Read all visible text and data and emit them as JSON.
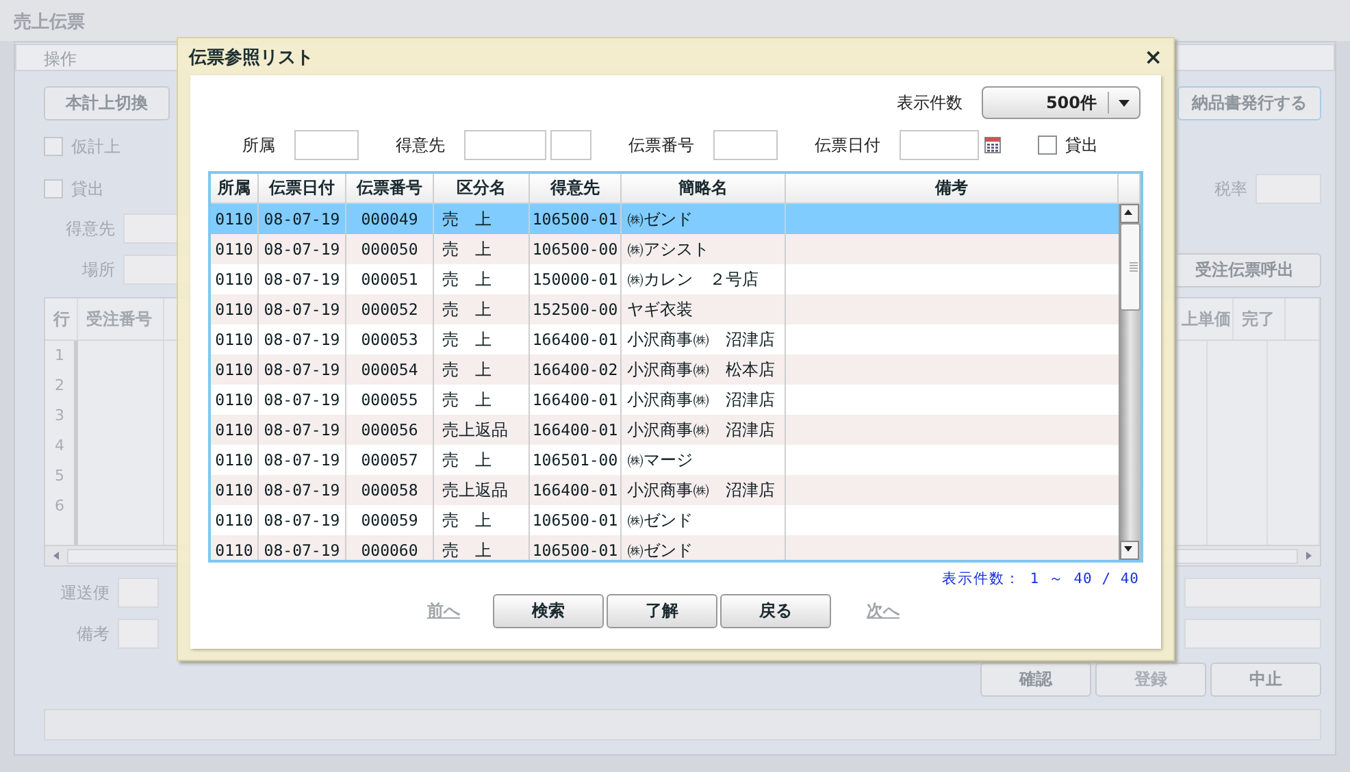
{
  "app": {
    "title": "売上伝票",
    "menu_tab": "操作",
    "top_buttons": [
      {
        "label": "本計上切換"
      },
      {
        "label": "納品書発行する"
      }
    ],
    "checkboxes": [
      {
        "label": "仮計上",
        "checked": false
      },
      {
        "label": "貸出",
        "checked": false
      }
    ],
    "fields": [
      {
        "label": "得意先"
      },
      {
        "label": "場所"
      }
    ],
    "tax_label": "税率",
    "call_button": "受注伝票呼出",
    "grid": {
      "columns_left": [
        "行",
        "受注番号"
      ],
      "columns_right": [
        "上単価",
        "完了"
      ],
      "row_numbers": [
        "1",
        "2",
        "3",
        "4",
        "5",
        "6"
      ]
    },
    "bottom_fields": [
      {
        "label": "運送便"
      },
      {
        "label": "備考"
      }
    ],
    "actions": [
      {
        "label": "確認",
        "disabled": false
      },
      {
        "label": "登録",
        "disabled": true
      },
      {
        "label": "中止",
        "disabled": false
      }
    ]
  },
  "dialog": {
    "title": "伝票参照リスト",
    "close": "×",
    "page_size": {
      "label": "表示件数",
      "value": "500件"
    },
    "filters": [
      {
        "label": "所属",
        "kind": "text"
      },
      {
        "label": "得意先",
        "kind": "split"
      },
      {
        "label": "伝票番号",
        "kind": "text"
      },
      {
        "label": "伝票日付",
        "kind": "date"
      },
      {
        "label": "貸出",
        "kind": "checkbox",
        "checked": false
      }
    ],
    "columns": [
      "所属",
      "伝票日付",
      "伝票番号",
      "区分名",
      "得意先",
      "簡略名",
      "備考"
    ],
    "rows": [
      {
        "cells": [
          "0110",
          "08-07-19",
          "000049",
          "売　上",
          "106500-01",
          "㈱ゼンド",
          ""
        ],
        "selected": true
      },
      {
        "cells": [
          "0110",
          "08-07-19",
          "000050",
          "売　上",
          "106500-00",
          "㈱アシスト",
          ""
        ],
        "selected": false
      },
      {
        "cells": [
          "0110",
          "08-07-19",
          "000051",
          "売　上",
          "150000-01",
          "㈱カレン　２号店",
          ""
        ],
        "selected": false
      },
      {
        "cells": [
          "0110",
          "08-07-19",
          "000052",
          "売　上",
          "152500-00",
          "ヤギ衣装",
          ""
        ],
        "selected": false
      },
      {
        "cells": [
          "0110",
          "08-07-19",
          "000053",
          "売　上",
          "166400-01",
          "小沢商事㈱　沼津店",
          ""
        ],
        "selected": false
      },
      {
        "cells": [
          "0110",
          "08-07-19",
          "000054",
          "売　上",
          "166400-02",
          "小沢商事㈱　松本店",
          ""
        ],
        "selected": false
      },
      {
        "cells": [
          "0110",
          "08-07-19",
          "000055",
          "売　上",
          "166400-01",
          "小沢商事㈱　沼津店",
          ""
        ],
        "selected": false
      },
      {
        "cells": [
          "0110",
          "08-07-19",
          "000056",
          "売上返品",
          "166400-01",
          "小沢商事㈱　沼津店",
          ""
        ],
        "selected": false
      },
      {
        "cells": [
          "0110",
          "08-07-19",
          "000057",
          "売　上",
          "106501-00",
          "㈱マージ",
          ""
        ],
        "selected": false
      },
      {
        "cells": [
          "0110",
          "08-07-19",
          "000058",
          "売上返品",
          "166400-01",
          "小沢商事㈱　沼津店",
          ""
        ],
        "selected": false
      },
      {
        "cells": [
          "0110",
          "08-07-19",
          "000059",
          "売　上",
          "106500-01",
          "㈱ゼンド",
          ""
        ],
        "selected": false
      },
      {
        "cells": [
          "0110",
          "08-07-19",
          "000060",
          "売　上",
          "106500-01",
          "㈱ゼンド",
          ""
        ],
        "selected": false
      }
    ],
    "count_text": "表示件数： 1 ～ 40 / 40",
    "prev": {
      "label": "前へ",
      "disabled": true
    },
    "buttons": [
      "検索",
      "了解",
      "戻る"
    ],
    "next": {
      "label": "次へ",
      "disabled": true
    }
  }
}
